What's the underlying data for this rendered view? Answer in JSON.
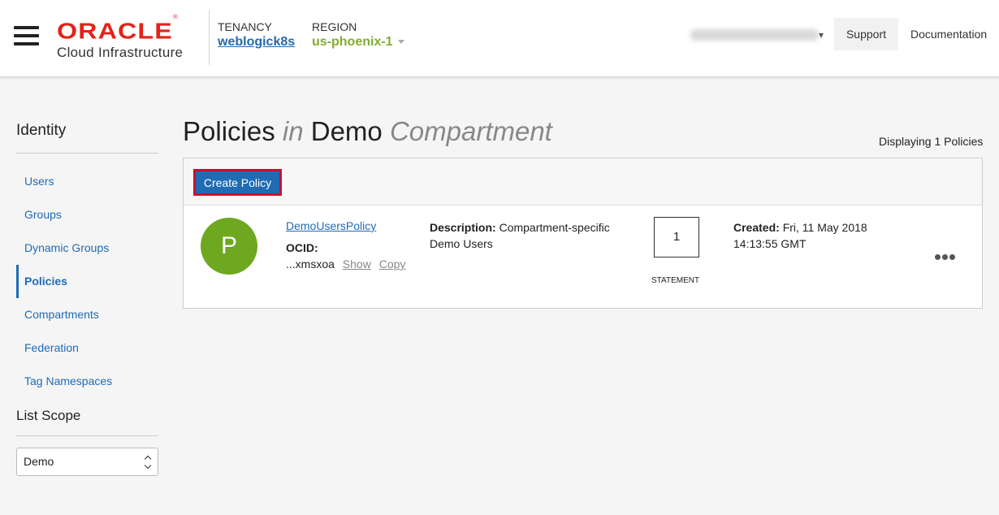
{
  "header": {
    "logo_brand": "ORACLE",
    "logo_mark": "®",
    "logo_sub": "Cloud Infrastructure",
    "tenancy_label": "TENANCY",
    "tenancy_value": "weblogick8s",
    "region_label": "REGION",
    "region_value": "us-phoenix-1",
    "support_label": "Support",
    "documentation_label": "Documentation"
  },
  "sidebar": {
    "title": "Identity",
    "items": [
      {
        "label": "Users"
      },
      {
        "label": "Groups"
      },
      {
        "label": "Dynamic Groups"
      },
      {
        "label": "Policies"
      },
      {
        "label": "Compartments"
      },
      {
        "label": "Federation"
      },
      {
        "label": "Tag Namespaces"
      }
    ],
    "active_index": 3,
    "scope_title": "List Scope",
    "scope_value": "Demo"
  },
  "main": {
    "title_part1": "Policies",
    "title_in": "in",
    "title_part2": "Demo",
    "title_part3": "Compartment",
    "display_count": "Displaying 1 Policies",
    "create_button": "Create Policy",
    "policies": [
      {
        "avatar_letter": "P",
        "name": "DemoUsersPolicy",
        "ocid_label": "OCID:",
        "ocid_value": "...xmsxoa",
        "show_label": "Show",
        "copy_label": "Copy",
        "description_label": "Description:",
        "description_value": "Compartment-specific Demo Users",
        "statement_count": "1",
        "statement_label": "STATEMENT",
        "created_label": "Created:",
        "created_value": "Fri, 11 May 2018 14:13:55 GMT"
      }
    ]
  },
  "colors": {
    "accent_blue": "#1f6bb4",
    "brand_red": "#e2231a",
    "region_green": "#7fae2e",
    "avatar_green": "#6ea820",
    "highlight_red": "#c8102e"
  },
  "icons": [
    "hamburger-menu-icon",
    "chevron-down-icon",
    "select-arrows-icon",
    "more-options-icon"
  ]
}
